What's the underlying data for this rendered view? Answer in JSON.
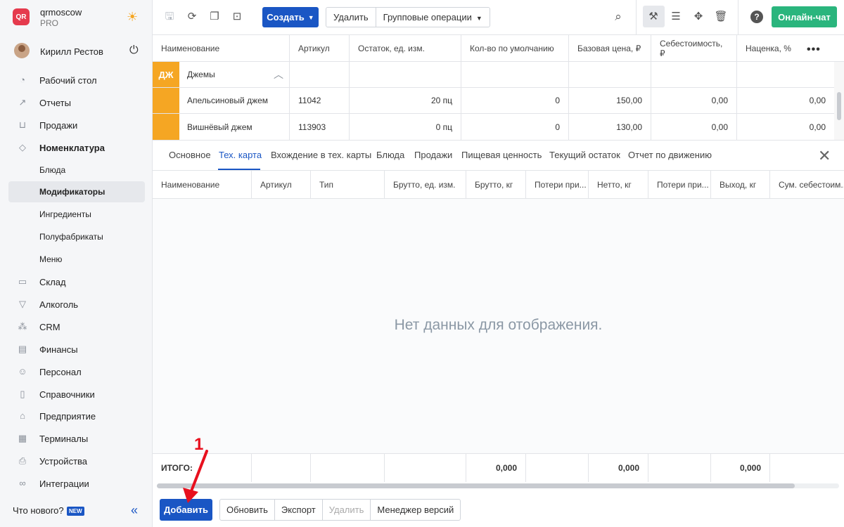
{
  "brand": {
    "name": "qrmoscow",
    "plan": "PRO",
    "logo_text": "QR"
  },
  "user": {
    "name": "Кирилл Рестов"
  },
  "sidebar": {
    "items": [
      {
        "label": "Рабочий стол",
        "icon": "dashboard-icon"
      },
      {
        "label": "Отчеты",
        "icon": "reports-icon"
      },
      {
        "label": "Продажи",
        "icon": "basket-icon"
      },
      {
        "label": "Номенклатура",
        "icon": "tag-icon"
      },
      {
        "label": "Блюда"
      },
      {
        "label": "Модификаторы"
      },
      {
        "label": "Ингредиенты"
      },
      {
        "label": "Полуфабрикаты"
      },
      {
        "label": "Меню"
      },
      {
        "label": "Склад",
        "icon": "box-icon"
      },
      {
        "label": "Алкоголь",
        "icon": "glass-icon"
      },
      {
        "label": "CRM",
        "icon": "crm-icon"
      },
      {
        "label": "Финансы",
        "icon": "wallet-icon"
      },
      {
        "label": "Персонал",
        "icon": "person-icon"
      },
      {
        "label": "Справочники",
        "icon": "book-icon"
      },
      {
        "label": "Предприятие",
        "icon": "store-icon"
      },
      {
        "label": "Терминалы",
        "icon": "qr-icon"
      },
      {
        "label": "Устройства",
        "icon": "printer-icon"
      },
      {
        "label": "Интеграции",
        "icon": "link-icon"
      }
    ],
    "whats_new": "Что нового?",
    "new_badge": "NEW"
  },
  "toolbar": {
    "create_label": "Создать",
    "delete_label": "Удалить",
    "group_ops_label": "Групповые операции",
    "chat_label": "Онлайн-чат"
  },
  "grid": {
    "columns": [
      "Наименование",
      "Артикул",
      "Остаток, ед. изм.",
      "Кол-во по умолчанию",
      "Базовая цена, ₽",
      "Себестоимость, ₽",
      "Наценка, %"
    ],
    "group": {
      "badge": "ДЖ",
      "name": "Джемы",
      "badge_color": "#f5a623"
    },
    "rows": [
      {
        "name": "Апельсиновый джем",
        "sku": "11042",
        "stock": "20 пц",
        "default_qty": "0",
        "base_price": "150,00",
        "cost": "0,00",
        "markup": "0,00"
      },
      {
        "name": "Вишнёвый джем",
        "sku": "113903",
        "stock": "0 пц",
        "default_qty": "0",
        "base_price": "130,00",
        "cost": "0,00",
        "markup": "0,00"
      }
    ]
  },
  "tabs": [
    "Основное",
    "Тех. карта",
    "Вхождение в тех. карты",
    "Блюда",
    "Продажи",
    "Пищевая ценность",
    "Текущий остаток",
    "Отчет по движению"
  ],
  "active_tab": "Тех. карта",
  "detail": {
    "columns": [
      "Наименование",
      "Артикул",
      "Тип",
      "Брутто, ед. изм.",
      "Брутто, кг",
      "Потери при...",
      "Нетто, кг",
      "Потери при...",
      "Выход, кг",
      "Сум. себестоим..."
    ],
    "empty_message": "Нет данных для отображения.",
    "totals_label": "ИТОГО:",
    "totals": {
      "brutto_kg": "0,000",
      "netto_kg": "0,000",
      "output_kg": "0,000"
    }
  },
  "bottom": {
    "add_label": "Добавить",
    "refresh_label": "Обновить",
    "export_label": "Экспорт",
    "delete_label": "Удалить",
    "versions_label": "Менеджер версий"
  },
  "annotation": {
    "number": "1"
  },
  "colors": {
    "primary": "#1a56c4",
    "success": "#2ab57d",
    "group": "#f5a623",
    "annotation": "#e8101e"
  }
}
